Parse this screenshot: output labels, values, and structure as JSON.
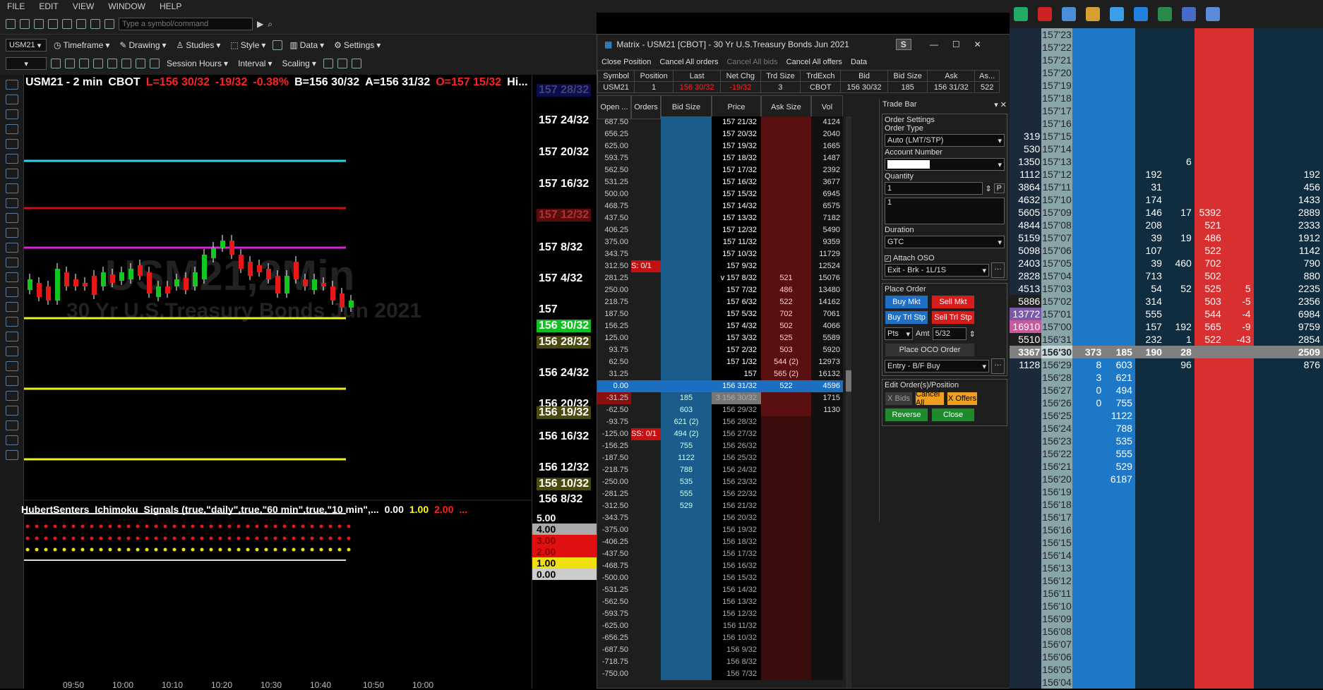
{
  "menu": [
    "FILE",
    "EDIT",
    "VIEW",
    "WINDOW",
    "HELP"
  ],
  "symbol_input_placeholder": "Type a symbol/command",
  "toolbar": {
    "symbol": "USM21",
    "timeframe": "Timeframe",
    "drawing": "Drawing",
    "studies": "Studies",
    "style": "Style",
    "data": "Data",
    "settings": "Settings",
    "session_hours": "Session Hours",
    "interval": "Interval",
    "scaling": "Scaling"
  },
  "chart": {
    "symbol": "USM21 - 2 min",
    "exchange": "CBOT",
    "last": "L=156 30/32",
    "chg": "-19/32",
    "pct": "-0.38%",
    "bid": "B=156 30/32",
    "ask": "A=156 31/32",
    "open": "O=157 15/32",
    "hi": "Hi...",
    "wm1": "USM21,2Min",
    "wm2": "30 Yr U.S.Treasury Bonds Jun 2021",
    "indicator": "HubertSenters_Ichimoku_Signals (true,\"daily\",true,\"60 min\",true,\"10 min\",...",
    "ind_v1": "0.00",
    "ind_v2": "1.00",
    "ind_v3": "2.00",
    "ind_more": "...",
    "times": [
      "09:50",
      "10:00",
      "10:10",
      "10:20",
      "10:30",
      "10:40",
      "10:50",
      "10:00"
    ]
  },
  "axis": {
    "labels": [
      "157 28/32",
      "157 24/32",
      "157 20/32",
      "157 16/32",
      "157 12/32",
      "157 8/32",
      "157 4/32",
      "157",
      "156 30/32",
      "156 28/32",
      "156 24/32",
      "156 20/32",
      "156 19/32",
      "156 16/32",
      "156 12/32",
      "156 10/32",
      "156 8/32"
    ],
    "ind_labels": [
      "5.00",
      "4.00",
      "3.00",
      "2.00",
      "1.00",
      "0.00"
    ]
  },
  "matrix": {
    "title": "Matrix - USM21 [CBOT] - 30 Yr U.S.Treasury Bonds Jun 2021",
    "s_badge": "S",
    "close_position": "Close Position",
    "cancel_all_orders": "Cancel All orders",
    "cancel_all_bids": "Cancel All bids",
    "cancel_all_offers": "Cancel All offers",
    "data": "Data",
    "quote_headers": [
      "Symbol",
      "Position",
      "Last",
      "Net Chg",
      "Trd Size",
      "TrdExch",
      "Bid",
      "Bid Size",
      "Ask",
      "As..."
    ],
    "quote_values": [
      "USM21",
      "1",
      "156 30/32",
      "-19/32",
      "3",
      "CBOT",
      "156 30/32",
      "185",
      "156 31/32",
      "522"
    ],
    "ladder_headers": [
      "Open ...",
      "Orders",
      "Bid Size",
      "Price",
      "Ask Size",
      "Vol"
    ],
    "rows": [
      [
        "687.50",
        "",
        "",
        "157 21/32",
        "",
        "4124"
      ],
      [
        "656.25",
        "",
        "",
        "157 20/32",
        "",
        "2040"
      ],
      [
        "625.00",
        "",
        "",
        "157 19/32",
        "",
        "1665"
      ],
      [
        "593.75",
        "",
        "",
        "157 18/32",
        "",
        "1487"
      ],
      [
        "562.50",
        "",
        "",
        "157 17/32",
        "",
        "2392"
      ],
      [
        "531.25",
        "",
        "",
        "157 16/32",
        "",
        "3677"
      ],
      [
        "500.00",
        "",
        "",
        "157 15/32",
        "",
        "6945"
      ],
      [
        "468.75",
        "",
        "",
        "157 14/32",
        "",
        "6575"
      ],
      [
        "437.50",
        "",
        "",
        "157 13/32",
        "",
        "7182"
      ],
      [
        "406.25",
        "",
        "",
        "157 12/32",
        "",
        "5490"
      ],
      [
        "375.00",
        "",
        "",
        "157 11/32",
        "",
        "9359"
      ],
      [
        "343.75",
        "",
        "",
        "157 10/32",
        "",
        "11729"
      ],
      [
        "312.50",
        "S: 0/1",
        "",
        "157 9/32",
        "",
        "12524"
      ],
      [
        "281.25",
        "",
        "",
        "v 157 8/32",
        "521",
        "15076"
      ],
      [
        "250.00",
        "",
        "",
        "157 7/32",
        "486",
        "13480"
      ],
      [
        "218.75",
        "",
        "",
        "157 6/32",
        "522",
        "14162"
      ],
      [
        "187.50",
        "",
        "",
        "157 5/32",
        "702",
        "7061"
      ],
      [
        "156.25",
        "",
        "",
        "157 4/32",
        "502",
        "4066"
      ],
      [
        "125.00",
        "",
        "",
        "157 3/32",
        "525",
        "5589"
      ],
      [
        "93.75",
        "",
        "",
        "157 2/32",
        "503",
        "5920"
      ],
      [
        "62.50",
        "",
        "",
        "157 1/32",
        "544  (2)",
        "12973"
      ],
      [
        "31.25",
        "",
        "",
        "157",
        "565  (2)",
        "16132"
      ],
      [
        "0.00",
        "",
        "",
        "156 31/32",
        "522",
        "4596"
      ],
      [
        "-31.25",
        "",
        "185",
        "3  156 30/32",
        "",
        "1715"
      ],
      [
        "-62.50",
        "",
        "603",
        "156 29/32",
        "",
        "1130"
      ],
      [
        "-93.75",
        "",
        "621  (2)",
        "156 28/32",
        "",
        ""
      ],
      [
        "-125.00",
        "SS: 0/1",
        "494  (2)",
        "156 27/32",
        "",
        ""
      ],
      [
        "-156.25",
        "",
        "755",
        "156 26/32",
        "",
        ""
      ],
      [
        "-187.50",
        "",
        "1122",
        "156 25/32",
        "",
        ""
      ],
      [
        "-218.75",
        "",
        "788",
        "156 24/32",
        "",
        ""
      ],
      [
        "-250.00",
        "",
        "535",
        "156 23/32",
        "",
        ""
      ],
      [
        "-281.25",
        "",
        "555",
        "156 22/32",
        "",
        ""
      ],
      [
        "-312.50",
        "",
        "529",
        "156 21/32",
        "",
        ""
      ],
      [
        "-343.75",
        "",
        "",
        "156 20/32",
        "",
        ""
      ],
      [
        "-375.00",
        "",
        "",
        "156 19/32",
        "",
        ""
      ],
      [
        "-406.25",
        "",
        "",
        "156 18/32",
        "",
        ""
      ],
      [
        "-437.50",
        "",
        "",
        "156 17/32",
        "",
        ""
      ],
      [
        "-468.75",
        "",
        "",
        "156 16/32",
        "",
        ""
      ],
      [
        "-500.00",
        "",
        "",
        "156 15/32",
        "",
        ""
      ],
      [
        "-531.25",
        "",
        "",
        "156 14/32",
        "",
        ""
      ],
      [
        "-562.50",
        "",
        "",
        "156 13/32",
        "",
        ""
      ],
      [
        "-593.75",
        "",
        "",
        "156 12/32",
        "",
        ""
      ],
      [
        "-625.00",
        "",
        "",
        "156 11/32",
        "",
        ""
      ],
      [
        "-656.25",
        "",
        "",
        "156 10/32",
        "",
        ""
      ],
      [
        "-687.50",
        "",
        "",
        "156 9/32",
        "",
        ""
      ],
      [
        "-718.75",
        "",
        "",
        "156 8/32",
        "",
        ""
      ],
      [
        "-750.00",
        "",
        "",
        "156 7/32",
        "",
        ""
      ]
    ]
  },
  "tradebar": {
    "title": "Trade Bar",
    "order_settings": "Order Settings",
    "order_type_label": "Order Type",
    "order_type": "Auto (LMT/STP)",
    "account_label": "Account Number",
    "quantity_label": "Quantity",
    "quantity": "1",
    "qty_list": "1",
    "p_btn": "P",
    "duration_label": "Duration",
    "duration": "GTC",
    "attach_oso": "Attach OSO",
    "oso": "Exit - Brk - 1L/1S",
    "place_order": "Place Order",
    "buy_mkt": "Buy Mkt",
    "sell_mkt": "Sell Mkt",
    "buy_trl": "Buy Trl Stp",
    "sell_trl": "Sell Trl Stp",
    "pts": "Pts",
    "amt_label": "Amt",
    "amt": "5/32",
    "place_oco": "Place OCO Order",
    "entry": "Entry - B/F Buy",
    "edit_orders": "Edit Order(s)/Position",
    "x_bids": "X Bids",
    "cancel_all": "Cancel All",
    "x_offers": "X Offers",
    "reverse": "Reverse",
    "close": "Close"
  },
  "dom": {
    "rows": [
      [
        "",
        "157'23",
        "",
        "",
        "",
        "",
        "",
        "",
        "",
        ""
      ],
      [
        "",
        "157'22",
        "",
        "",
        "",
        "",
        "",
        "",
        "",
        ""
      ],
      [
        "",
        "157'21",
        "",
        "",
        "",
        "",
        "",
        "",
        "",
        ""
      ],
      [
        "",
        "157'20",
        "",
        "",
        "",
        "",
        "",
        "",
        "",
        ""
      ],
      [
        "",
        "157'19",
        "",
        "",
        "",
        "",
        "",
        "",
        "",
        ""
      ],
      [
        "",
        "157'18",
        "",
        "",
        "",
        "",
        "",
        "",
        "",
        ""
      ],
      [
        "",
        "157'17",
        "",
        "",
        "",
        "",
        "",
        "",
        "",
        ""
      ],
      [
        "",
        "157'16",
        "",
        "",
        "",
        "",
        "",
        "",
        "",
        ""
      ],
      [
        "319",
        "157'15",
        "",
        "",
        "",
        "",
        "",
        "",
        "",
        ""
      ],
      [
        "530",
        "157'14",
        "",
        "",
        "",
        "",
        "",
        "",
        "",
        ""
      ],
      [
        "1350",
        "157'13",
        "",
        "",
        "",
        "6",
        "",
        "",
        "",
        ""
      ],
      [
        "1112",
        "157'12",
        "",
        "",
        "192",
        "",
        "",
        "",
        "",
        "192"
      ],
      [
        "3864",
        "157'11",
        "",
        "",
        "31",
        "",
        "",
        "",
        "",
        "456"
      ],
      [
        "4632",
        "157'10",
        "",
        "",
        "174",
        "",
        "",
        "",
        "",
        "1433"
      ],
      [
        "5605",
        "157'09",
        "",
        "",
        "146",
        "17",
        "5392",
        "",
        "",
        "2889"
      ],
      [
        "4844",
        "157'08",
        "",
        "",
        "208",
        "",
        "521",
        "",
        "",
        "2333"
      ],
      [
        "5159",
        "157'07",
        "",
        "",
        "39",
        "19",
        "486",
        "",
        "",
        "1912"
      ],
      [
        "5098",
        "157'06",
        "",
        "",
        "107",
        "",
        "522",
        "",
        "",
        "1142"
      ],
      [
        "2403",
        "157'05",
        "",
        "",
        "39",
        "460",
        "702",
        "",
        "",
        "790"
      ],
      [
        "2828",
        "157'04",
        "",
        "",
        "713",
        "",
        "502",
        "",
        "",
        "880"
      ],
      [
        "4513",
        "157'03",
        "",
        "",
        "54",
        "52",
        "525",
        "5",
        "",
        "2235"
      ],
      [
        "5886",
        "157'02",
        "",
        "",
        "314",
        "",
        "503",
        "-5",
        "",
        "2356"
      ],
      [
        "13772",
        "157'01",
        "",
        "",
        "555",
        "",
        "544",
        "-4",
        "",
        "6984"
      ],
      [
        "16910",
        "157'00",
        "",
        "",
        "157",
        "192",
        "565",
        "-9",
        "",
        "9759"
      ],
      [
        "5510",
        "156'31",
        "",
        "",
        "232",
        "1",
        "522",
        "-43",
        "",
        "2854"
      ],
      [
        "3367",
        "156'30",
        "373",
        "185",
        "190",
        "28",
        "",
        "",
        "",
        "2509"
      ],
      [
        "1128",
        "156'29",
        "8",
        "603",
        "",
        "96",
        "",
        "",
        "",
        "876"
      ],
      [
        "",
        "156'28",
        "3",
        "621",
        "",
        "",
        "",
        "",
        "",
        ""
      ],
      [
        "",
        "156'27",
        "0",
        "494",
        "",
        "",
        "",
        "",
        "",
        ""
      ],
      [
        "",
        "156'26",
        "0",
        "755",
        "",
        "",
        "",
        "",
        "",
        ""
      ],
      [
        "",
        "156'25",
        "",
        "1122",
        "",
        "",
        "",
        "",
        "",
        ""
      ],
      [
        "",
        "156'24",
        "",
        "788",
        "",
        "",
        "",
        "",
        "",
        ""
      ],
      [
        "",
        "156'23",
        "",
        "535",
        "",
        "",
        "",
        "",
        "",
        ""
      ],
      [
        "",
        "156'22",
        "",
        "555",
        "",
        "",
        "",
        "",
        "",
        ""
      ],
      [
        "",
        "156'21",
        "",
        "529",
        "",
        "",
        "",
        "",
        "",
        ""
      ],
      [
        "",
        "156'20",
        "",
        "6187",
        "",
        "",
        "",
        "",
        "",
        ""
      ],
      [
        "",
        "156'19",
        "",
        "",
        "",
        "",
        "",
        "",
        "",
        ""
      ],
      [
        "",
        "156'18",
        "",
        "",
        "",
        "",
        "",
        "",
        "",
        ""
      ],
      [
        "",
        "156'17",
        "",
        "",
        "",
        "",
        "",
        "",
        "",
        ""
      ],
      [
        "",
        "156'16",
        "",
        "",
        "",
        "",
        "",
        "",
        "",
        ""
      ],
      [
        "",
        "156'15",
        "",
        "",
        "",
        "",
        "",
        "",
        "",
        ""
      ],
      [
        "",
        "156'14",
        "",
        "",
        "",
        "",
        "",
        "",
        "",
        ""
      ],
      [
        "",
        "156'13",
        "",
        "",
        "",
        "",
        "",
        "",
        "",
        ""
      ],
      [
        "",
        "156'12",
        "",
        "",
        "",
        "",
        "",
        "",
        "",
        ""
      ],
      [
        "",
        "156'11",
        "",
        "",
        "",
        "",
        "",
        "",
        "",
        ""
      ],
      [
        "",
        "156'10",
        "",
        "",
        "",
        "",
        "",
        "",
        "",
        ""
      ],
      [
        "",
        "156'09",
        "",
        "",
        "",
        "",
        "",
        "",
        "",
        ""
      ],
      [
        "",
        "156'08",
        "",
        "",
        "",
        "",
        "",
        "",
        "",
        ""
      ],
      [
        "",
        "156'07",
        "",
        "",
        "",
        "",
        "",
        "",
        "",
        ""
      ],
      [
        "",
        "156'06",
        "",
        "",
        "",
        "",
        "",
        "",
        "",
        ""
      ],
      [
        "",
        "156'05",
        "",
        "",
        "",
        "",
        "",
        "",
        "",
        ""
      ],
      [
        "",
        "156'04",
        "",
        "",
        "",
        "",
        "",
        "",
        "",
        ""
      ]
    ]
  }
}
